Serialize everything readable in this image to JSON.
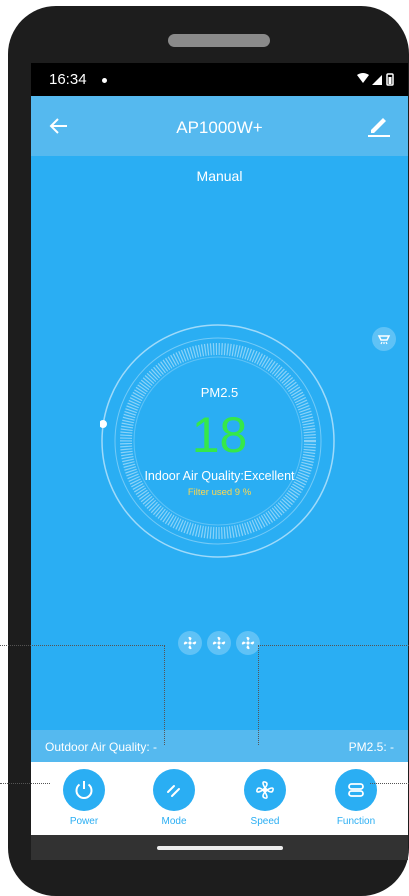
{
  "status_bar": {
    "time": "16:34"
  },
  "app_bar": {
    "title": "AP1000W+"
  },
  "mode": {
    "label": "Manual"
  },
  "dial": {
    "pm_label": "PM2.5",
    "pm_value": "18",
    "indoor_quality": "Indoor Air Quality:Excellent",
    "filter_used": "Filter used 9 %"
  },
  "outdoor": {
    "quality": "Outdoor Air Quality: -",
    "pm": "PM2.5: -"
  },
  "controls": [
    {
      "label": "Power",
      "icon": "power-icon"
    },
    {
      "label": "Mode",
      "icon": "mode-icon"
    },
    {
      "label": "Speed",
      "icon": "fan-icon"
    },
    {
      "label": "Function",
      "icon": "function-icon"
    }
  ],
  "colors": {
    "accent": "#2aaef3",
    "app_bar": "#55b9ef",
    "pm_value": "#35e84a",
    "filter_text": "#ffd84d"
  }
}
